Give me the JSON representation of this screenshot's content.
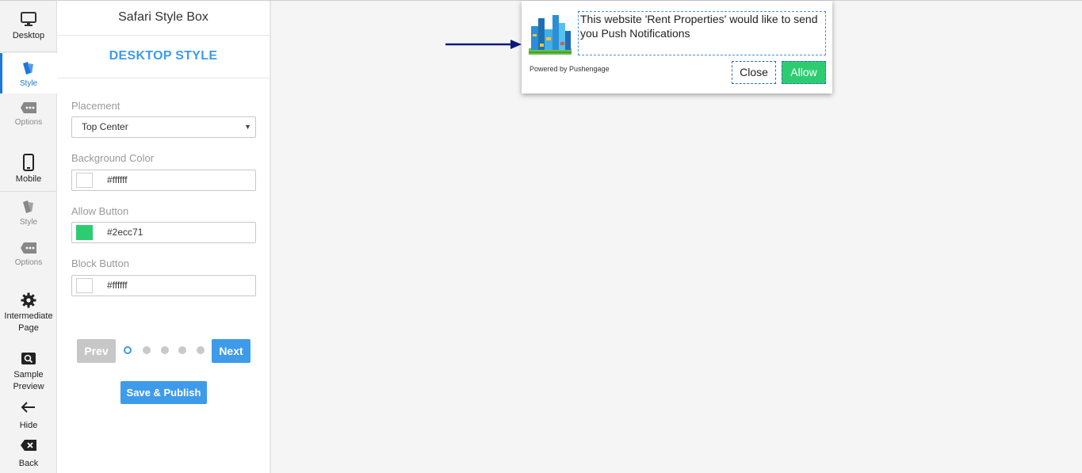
{
  "rail": {
    "desktop": "Desktop",
    "desktop_style": "Style",
    "desktop_options": "Options",
    "mobile": "Mobile",
    "mobile_style": "Style",
    "mobile_options": "Options",
    "intermediate_line1": "Intermediate",
    "intermediate_line2": "Page",
    "sample_line1": "Sample",
    "sample_line2": "Preview",
    "hide": "Hide",
    "back": "Back"
  },
  "panel": {
    "title": "Safari Style Box",
    "subtitle": "DESKTOP STYLE",
    "placement_label": "Placement",
    "placement_value": "Top Center",
    "bg_label": "Background Color",
    "bg_value": "#ffffff",
    "allow_label": "Allow Button",
    "allow_value": "#2ecc71",
    "block_label": "Block Button",
    "block_value": "#ffffff",
    "prev": "Prev",
    "next": "Next",
    "save": "Save & Publish",
    "step_total": 5,
    "step_current": 1
  },
  "preview": {
    "message": "This website 'Rent Properties' would like to send you Push Notifications",
    "powered": "Powered by Pushengage",
    "close": "Close",
    "allow": "Allow"
  },
  "colors": {
    "accent": "#3d9bea",
    "allow_green": "#2ecc71",
    "active_blue": "#1e78d7"
  }
}
